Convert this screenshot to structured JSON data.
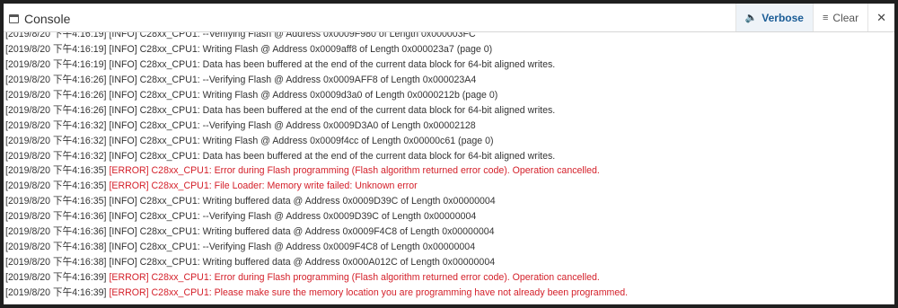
{
  "header": {
    "title": "Console",
    "buttons": [
      {
        "label": "Verbose",
        "icon": "speaker-icon"
      },
      {
        "label": "Clear",
        "icon": "clear-lines-icon"
      },
      {
        "label": "✕",
        "icon": "close-icon"
      }
    ]
  },
  "colors": {
    "error": "#d4202a",
    "info": "#333333",
    "accent": "#1a5c96"
  },
  "log": [
    {
      "ts": "[2019/8/20 下午4:16:19]",
      "msg": " [INFO] C28xx_CPU1: --Verifying Flash @ Address 0x0009F980 of Length 0x000003FC",
      "level": "info"
    },
    {
      "ts": "[2019/8/20 下午4:16:19]",
      "msg": " [INFO] C28xx_CPU1: Writing Flash @ Address 0x0009aff8 of Length 0x000023a7 (page 0)",
      "level": "info"
    },
    {
      "ts": "[2019/8/20 下午4:16:19]",
      "msg": " [INFO] C28xx_CPU1: Data has been buffered at the end of the current data block for 64-bit aligned writes.",
      "level": "info"
    },
    {
      "ts": "[2019/8/20 下午4:16:26]",
      "msg": " [INFO] C28xx_CPU1: --Verifying Flash @ Address 0x0009AFF8 of Length 0x000023A4",
      "level": "info"
    },
    {
      "ts": "[2019/8/20 下午4:16:26]",
      "msg": " [INFO] C28xx_CPU1: Writing Flash @ Address 0x0009d3a0 of Length 0x0000212b (page 0)",
      "level": "info"
    },
    {
      "ts": "[2019/8/20 下午4:16:26]",
      "msg": " [INFO] C28xx_CPU1: Data has been buffered at the end of the current data block for 64-bit aligned writes.",
      "level": "info"
    },
    {
      "ts": "[2019/8/20 下午4:16:32]",
      "msg": " [INFO] C28xx_CPU1: --Verifying Flash @ Address 0x0009D3A0 of Length 0x00002128",
      "level": "info"
    },
    {
      "ts": "[2019/8/20 下午4:16:32]",
      "msg": " [INFO] C28xx_CPU1: Writing Flash @ Address 0x0009f4cc of Length 0x00000c61 (page 0)",
      "level": "info"
    },
    {
      "ts": "[2019/8/20 下午4:16:32]",
      "msg": " [INFO] C28xx_CPU1: Data has been buffered at the end of the current data block for 64-bit aligned writes.",
      "level": "info"
    },
    {
      "ts": "[2019/8/20 下午4:16:35]",
      "msg": " [ERROR] C28xx_CPU1: Error during Flash programming (Flash algorithm returned error code). Operation cancelled.",
      "level": "error"
    },
    {
      "ts": "[2019/8/20 下午4:16:35]",
      "msg": " [ERROR] C28xx_CPU1: File Loader: Memory write failed: Unknown error",
      "level": "error"
    },
    {
      "ts": "[2019/8/20 下午4:16:35]",
      "msg": " [INFO] C28xx_CPU1: Writing buffered data @ Address 0x0009D39C of Length 0x00000004",
      "level": "info"
    },
    {
      "ts": "[2019/8/20 下午4:16:36]",
      "msg": " [INFO] C28xx_CPU1: --Verifying Flash @ Address 0x0009D39C of Length 0x00000004",
      "level": "info"
    },
    {
      "ts": "[2019/8/20 下午4:16:36]",
      "msg": " [INFO] C28xx_CPU1: Writing buffered data @ Address 0x0009F4C8 of Length 0x00000004",
      "level": "info"
    },
    {
      "ts": "[2019/8/20 下午4:16:38]",
      "msg": " [INFO] C28xx_CPU1: --Verifying Flash @ Address 0x0009F4C8 of Length 0x00000004",
      "level": "info"
    },
    {
      "ts": "[2019/8/20 下午4:16:38]",
      "msg": " [INFO] C28xx_CPU1: Writing buffered data @ Address 0x000A012C of Length 0x00000004",
      "level": "info"
    },
    {
      "ts": "[2019/8/20 下午4:16:39]",
      "msg": " [ERROR] C28xx_CPU1: Error during Flash programming (Flash algorithm returned error code). Operation cancelled.",
      "level": "error"
    },
    {
      "ts": "[2019/8/20 下午4:16:39]",
      "msg": " [ERROR] C28xx_CPU1: Please make sure the memory location you are programming have not already been programmed.",
      "level": "error"
    }
  ]
}
